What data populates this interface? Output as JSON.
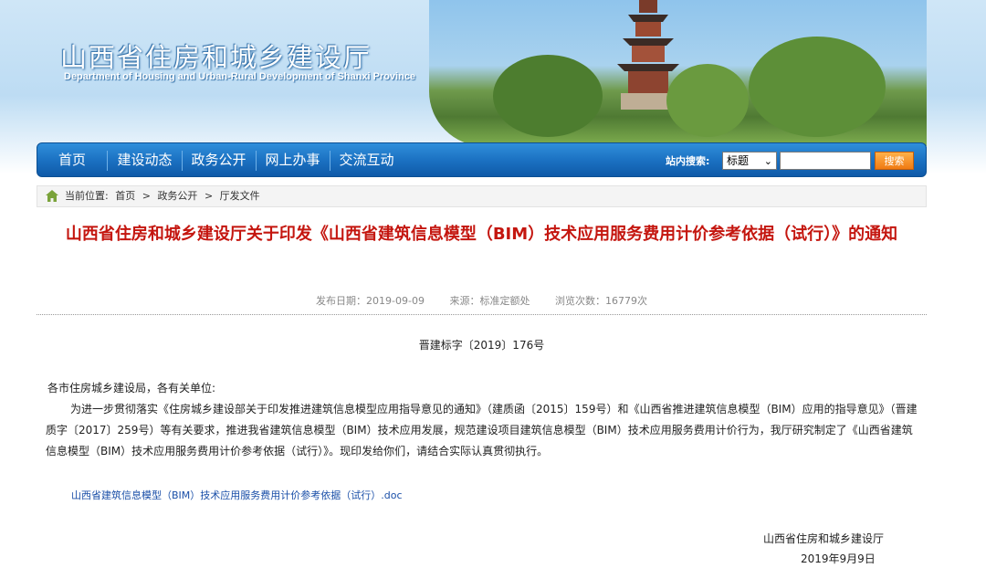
{
  "header": {
    "title": "山西省住房和城乡建设厅",
    "subtitle": "Department of Housing and Urban-Rural Development of Shanxi Province"
  },
  "nav": {
    "items": [
      "首页",
      "建设动态",
      "政务公开",
      "网上办事",
      "交流互动"
    ],
    "search_label": "站内搜索:",
    "search_select_value": "标题",
    "search_input_value": "",
    "search_button": "搜索"
  },
  "breadcrumb": {
    "prefix": "当前位置:",
    "items": [
      "首页",
      "政务公开",
      "厅发文件"
    ],
    "separator": ">"
  },
  "article": {
    "title": "山西省住房和城乡建设厅关于印发《山西省建筑信息模型（BIM）技术应用服务费用计价参考依据（试行）》的通知",
    "publish_date": "发布日期：2019-09-09",
    "source": "来源：标准定额处",
    "views": "浏览次数：16779次",
    "doc_number": "晋建标字〔2019〕176号",
    "salutation": "各市住房城乡建设局，各有关单位:",
    "body": "为进一步贯彻落实《住房城乡建设部关于印发推进建筑信息模型应用指导意见的通知》（建质函〔2015〕159号）和《山西省推进建筑信息模型（BIM）应用的指导意见》（晋建质字〔2017〕259号）等有关要求，推进我省建筑信息模型（BIM）技术应用发展，规范建设项目建筑信息模型（BIM）技术应用服务费用计价行为，我厅研究制定了《山西省建筑信息模型（BIM）技术应用服务费用计价参考依据（试行）》。现印发给你们，请结合实际认真贯彻执行。",
    "attachment": "山西省建筑信息模型（BIM）技术应用服务费用计价参考依据（试行）.doc",
    "signature_org": "山西省住房和城乡建设厅",
    "signature_date": "2019年9月9日"
  },
  "colors": {
    "nav_blue": "#1a6fc0",
    "title_red": "#c4160f",
    "link_blue": "#1a4fa8",
    "search_button_orange": "#f07a12"
  }
}
